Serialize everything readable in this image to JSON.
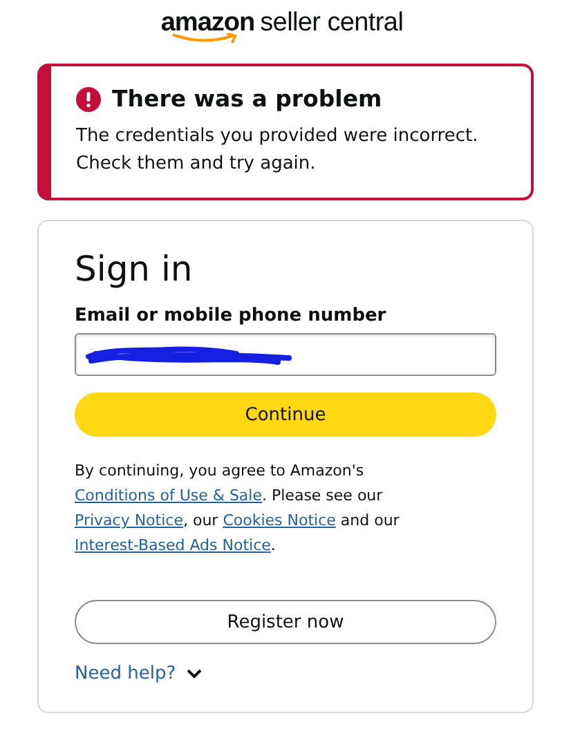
{
  "logo": {
    "brand": "amazon",
    "product": "seller central"
  },
  "alert": {
    "title": "There was a problem",
    "message": "The credentials you provided were incorrect. Check them and try again."
  },
  "signin": {
    "title": "Sign in",
    "field_label": "Email or mobile phone number",
    "value_redacted": true,
    "continue_button": "Continue",
    "legal": [
      {
        "text": "By continuing, you agree to Amazon's",
        "kind": "text"
      },
      {
        "text": "Conditions of Use & Sale",
        "kind": "link"
      },
      {
        "text": ". Please see our",
        "kind": "text"
      },
      {
        "text": "Privacy Notice",
        "kind": "link"
      },
      {
        "text": ", our",
        "kind": "text"
      },
      {
        "text": "Cookies Notice",
        "kind": "link"
      },
      {
        "text": "and our",
        "kind": "text"
      },
      {
        "text": "Interest-Based Ads Notice",
        "kind": "link"
      },
      {
        "text": ".",
        "kind": "text"
      }
    ],
    "register_button": "Register now",
    "help_link": "Need help?"
  }
}
